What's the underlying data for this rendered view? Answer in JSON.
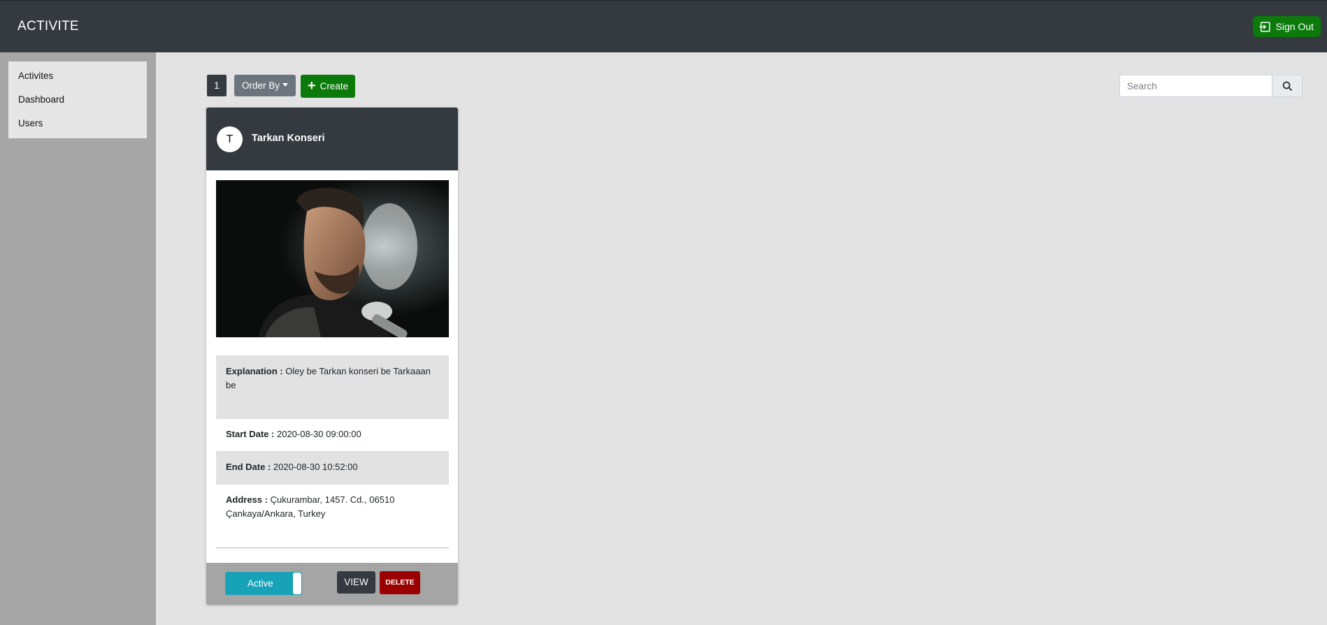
{
  "app": {
    "brand": "ACTIVITE",
    "signout_label": "Sign Out"
  },
  "sidebar": {
    "items": [
      {
        "label": "Activites"
      },
      {
        "label": "Dashboard"
      },
      {
        "label": "Users"
      }
    ]
  },
  "toolbar": {
    "page_number": "1",
    "order_by_label": "Order By",
    "create_label": "Create"
  },
  "search": {
    "placeholder": "Search",
    "value": ""
  },
  "activity": {
    "avatar_letter": "T",
    "title": "Tarkan Konseri",
    "explanation_label": "Explanation :",
    "explanation": "Oley be Tarkan konseri be Tarkaaan be",
    "start_label": "Start Date :",
    "start": "2020-08-30 09:00:00",
    "end_label": "End Date :",
    "end": "2020-08-30 10:52:00",
    "address_label": "Address :",
    "address": "Çukurambar, 1457. Cd., 06510 Çankaya/Ankara, Turkey",
    "status_label": "Active",
    "view_label": "VIEW",
    "delete_label": "DELETE"
  },
  "colors": {
    "topbar": "#343a40",
    "sidebar": "#a6a6a6",
    "success": "#0b7a0b",
    "info": "#17a2b8",
    "danger": "#9a0000",
    "secondary": "#6c757d"
  }
}
